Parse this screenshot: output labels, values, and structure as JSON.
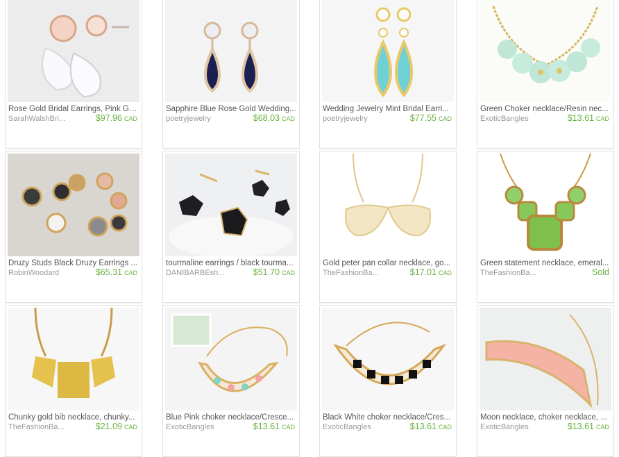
{
  "listings": [
    {
      "title": "Rose Gold Bridal Earrings, Pink Gol...",
      "shop": "SarahWalshBri...",
      "price": "$97.96",
      "currency": "CAD",
      "icon": "rose-gold-teardrop-earrings"
    },
    {
      "title": "Sapphire Blue Rose Gold Wedding...",
      "shop": "poetryjewelry",
      "price": "$68.03",
      "currency": "CAD",
      "icon": "sapphire-teardrop-earrings"
    },
    {
      "title": "Wedding Jewelry Mint Bridal Earri...",
      "shop": "poetryjewelry",
      "price": "$77.55",
      "currency": "CAD",
      "icon": "mint-teardrop-earrings"
    },
    {
      "title": "Green Choker necklace/Resin nec...",
      "shop": "ExoticBangles",
      "price": "$13.61",
      "currency": "CAD",
      "icon": "flower-choker-necklace"
    },
    {
      "title": "Druzy Studs Black Druzy Earrings ...",
      "shop": "RobinWoodard",
      "price": "$65.31",
      "currency": "CAD",
      "icon": "druzy-stud-earrings"
    },
    {
      "title": "tourmaline earrings / black tourma...",
      "shop": "DANIBARBEsh...",
      "price": "$51.70",
      "currency": "CAD",
      "icon": "tourmaline-stud-earrings"
    },
    {
      "title": "Gold peter pan collar necklace, go...",
      "shop": "TheFashionBa...",
      "price": "$17.01",
      "currency": "CAD",
      "icon": "collar-necklace"
    },
    {
      "title": "Green statement necklace, emeral...",
      "shop": "TheFashionBa...",
      "price": "",
      "currency": "",
      "status": "Sold",
      "icon": "green-statement-necklace"
    },
    {
      "title": "Chunky gold bib necklace, chunky...",
      "shop": "TheFashionBa...",
      "price": "$21.09",
      "currency": "CAD",
      "icon": "gold-bib-necklace"
    },
    {
      "title": "Blue Pink choker necklace/Cresce...",
      "shop": "ExoticBangles",
      "price": "$13.61",
      "currency": "CAD",
      "icon": "pastel-crescent-necklace"
    },
    {
      "title": "Black White choker necklace/Cres...",
      "shop": "ExoticBangles",
      "price": "$13.61",
      "currency": "CAD",
      "icon": "black-white-crescent-necklace"
    },
    {
      "title": "Moon necklace, choker necklace, ...",
      "shop": "ExoticBangles",
      "price": "$13.61",
      "currency": "CAD",
      "icon": "pink-moon-necklace"
    }
  ],
  "colors": {
    "price": "#69b23f",
    "title": "#555555",
    "shop": "#999999",
    "border": "#e1e1e1"
  }
}
